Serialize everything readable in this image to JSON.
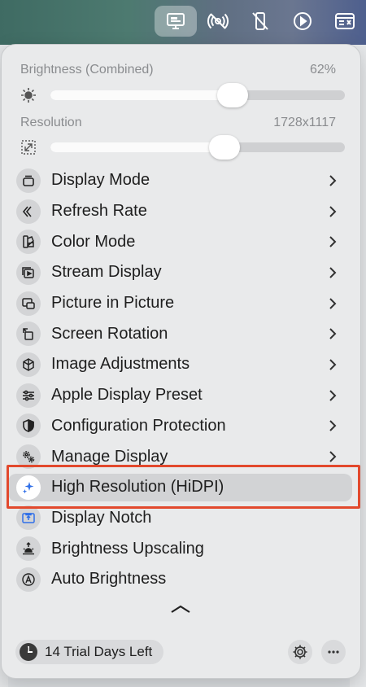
{
  "menubar": {
    "items": [
      {
        "icon": "display-icon",
        "active": true
      },
      {
        "icon": "no-wireless-icon",
        "active": false
      },
      {
        "icon": "no-mobile-icon",
        "active": false
      },
      {
        "icon": "play-icon",
        "active": false
      },
      {
        "icon": "keyboard-window-icon",
        "active": false
      }
    ]
  },
  "sliders": {
    "brightness": {
      "label": "Brightness (Combined)",
      "value_text": "62%",
      "level": 0.62,
      "icon": "sun-icon"
    },
    "resolution": {
      "label": "Resolution",
      "value_text": "1728x1117",
      "level": 0.59,
      "icon": "resize-icon"
    }
  },
  "menu": {
    "items": [
      {
        "label": "Display Mode",
        "icon": "display-mode-icon",
        "submenu": true
      },
      {
        "label": "Refresh Rate",
        "icon": "refresh-rate-icon",
        "submenu": true
      },
      {
        "label": "Color Mode",
        "icon": "color-mode-icon",
        "submenu": true
      },
      {
        "label": "Stream Display",
        "icon": "stream-display-icon",
        "submenu": true
      },
      {
        "label": "Picture in Picture",
        "icon": "picture-in-picture-icon",
        "submenu": true
      },
      {
        "label": "Screen Rotation",
        "icon": "screen-rotation-icon",
        "submenu": true
      },
      {
        "label": "Image Adjustments",
        "icon": "image-adjustments-icon",
        "submenu": true
      },
      {
        "label": "Apple Display Preset",
        "icon": "sliders-icon",
        "submenu": true
      },
      {
        "label": "Configuration Protection",
        "icon": "shield-icon",
        "submenu": true
      },
      {
        "label": "Manage Display",
        "icon": "gears-icon",
        "submenu": true
      },
      {
        "label": "High Resolution (HiDPI)",
        "icon": "sparkle-icon",
        "submenu": false,
        "highlighted": true
      },
      {
        "label": "Display Notch",
        "icon": "notch-icon",
        "submenu": false
      },
      {
        "label": "Brightness Upscaling",
        "icon": "sunrise-icon",
        "submenu": false
      },
      {
        "label": "Auto Brightness",
        "icon": "auto-a-icon",
        "submenu": false
      }
    ]
  },
  "footer": {
    "trial_text": "14 Trial Days Left",
    "trial_icon": "clock-icon",
    "settings_icon": "gear-icon",
    "more_icon": "ellipsis-icon"
  },
  "colors": {
    "highlight_outline": "#e2492d",
    "sparkle_blue": "#2f6fe8"
  }
}
